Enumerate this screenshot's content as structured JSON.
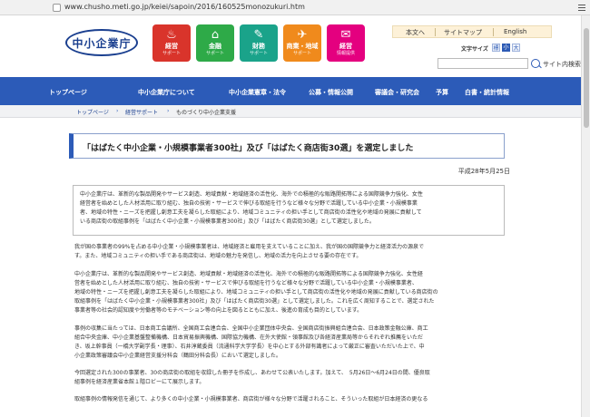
{
  "browser": {
    "url": "www.chusho.meti.go.jp/keiei/sapoin/2016/160525monozukuri.htm"
  },
  "header": {
    "logo_text": "中小企業庁",
    "categories": [
      {
        "label": "経営",
        "sub": "サポート",
        "color": "#d9342b",
        "icon": "tornado-icon",
        "glyph": "♨"
      },
      {
        "label": "金融",
        "sub": "サポート",
        "color": "#2eaa48",
        "icon": "bank-icon",
        "glyph": "⌂"
      },
      {
        "label": "財務",
        "sub": "サポート",
        "color": "#1aa38a",
        "icon": "pen-icon",
        "glyph": "✎"
      },
      {
        "label": "商業・地域",
        "sub": "サポート",
        "color": "#f08a1c",
        "icon": "cart-icon",
        "glyph": "✈"
      },
      {
        "label": "経営",
        "sub": "情報提供",
        "color": "#e4007f",
        "icon": "info-icon",
        "glyph": "✉"
      }
    ],
    "toplinks": [
      "本文へ",
      "サイトマップ",
      "English"
    ],
    "fontsize_label": "文字サイズ",
    "fontsize_std": "標",
    "fontsize_small": "小",
    "fontsize_large": "大",
    "search_placeholder": "",
    "search_label": "サイト内検索"
  },
  "nav": [
    "トップページ",
    "中小企業庁について",
    "中小企業憲章・法令",
    "公募・情報公開",
    "審議会・研究会",
    "予算",
    "白書・統計情報"
  ],
  "breadcrumb": [
    "トップページ",
    "経営サポート",
    "ものづくり中小企業支援"
  ],
  "page": {
    "title": "「はばたく中小企業・小規模事業者300社」及び「はばたく商店街30選」を選定しました",
    "date": "平成28年5月25日",
    "summary": [
      "中小企業庁は、革新的な製品開発やサービス創造、地域貢献・地域経済の活性化、海外での積極的な販路開拓等による国際競争力強化、女性",
      "経営者を始めとした人材活用に取り組む、独自の技術・サービスで伸びる取組を行うなど様々な分野で活躍している中小企業・小規模事業",
      "者、地域の特性・ニーズを把握し創意工夫を凝らした取組により、地域コミュニティの担い手として商店街の活性化や地域の発展に貢献して",
      "いる商店街の取組事例を「はばたく中小企業・小規模事業者300社」及び「はばたく商店街30選」として選定しました。"
    ],
    "para1": [
      "我が国の事業者の99%を占める中小企業・小規模事業者は、地域経済と雇用を支えていることに加え、我が国の国際競争力と経済活力の源泉で",
      "す。また、地域コミュニティの担い手である商店街は、地域の魅力を発信し、地域の活力を向上させる要の存在です。"
    ],
    "para2": [
      "中小企業庁は、革新的な製品開発やサービス創造、地域貢献・地域経済の活性化、海外での積極的な販路開拓等による国際競争力強化、女性経",
      "営者を始めとした人材活用に取り組む、独自の技術・サービスで伸びる取組を行うなど様々な分野で活躍している中小企業・小規模事業者、",
      "地域の特性・ニーズを把握し創意工夫を凝らした取組により、地域コミュニティの担い手として商店街の活性化や地域の発展に貢献している商店街の",
      "取組事例を「はばたく中小企業・小規模事業者300社」及び「はばたく商店街30選」として選定しました。これを広く周知することで、選定された",
      "事業者等の社会的認知度や労働者等のモチベーション等の向上を図るとともに加え、後進の育成も目的としています。"
    ],
    "para3": [
      "事例の収集に当たっては、日本商工会議所、全国商工会連合会、全国中小企業団体中央会、全国商店街振興組合連合会、日本政策金融公庫、商工",
      "組合中央金庫、中小企業基盤整備機構、日本貿易振興機構、国際協力機構、在外大使館・領事館及び各経済産業局等からそれぞれ推薦をいただ",
      "き、坂上幹事員（一橋大学副学長・理事）、石井淳蔵委員（流通科学大学学長）を中心とする外部有識者によって厳正に審査いただいた上で、中",
      "小企業政策審議会中小企業経営支援分科会（鶴田分科会長）において選定しました。"
    ],
    "para4": [
      "今回選定された300の事業者、30の商店街の取組を収録した冊子を作成し、あわせて公表いたします。加えて、　5月26日～6月24日の間、優良取",
      "組事例を経済産業省本館１階ロビーにて展示します。"
    ],
    "para5": [
      "取組事例の情報発信を通じて、より多くの中小企業・小規模事業者、商店街が様々な分野で活躍されること、そういった取組が日本経済の更なる"
    ]
  }
}
